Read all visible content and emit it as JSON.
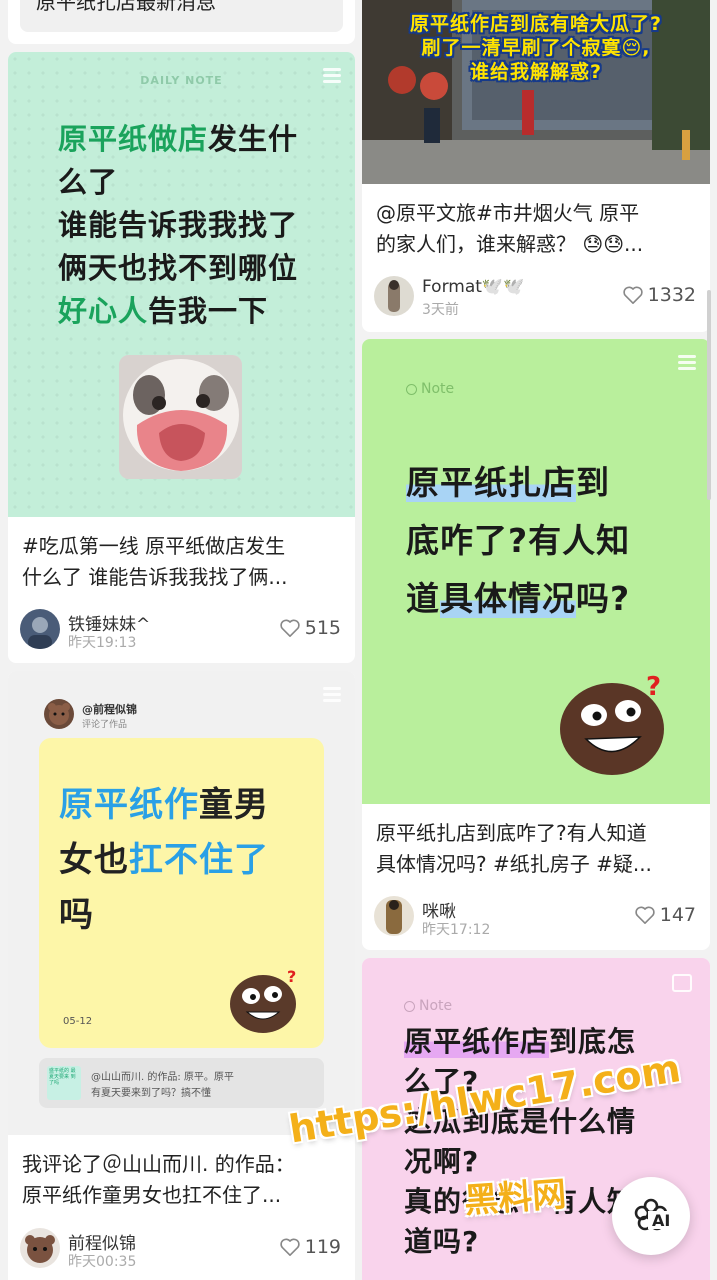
{
  "top_card": {
    "caption": "原平纸扎店最新消息"
  },
  "cards": {
    "c1": {
      "cover_tag": "DAILY NOTE",
      "cover_lines": [
        "原平纸做店发生什",
        "么了",
        "谁能告诉我我找了",
        "俩天也找不到哪位",
        "好心人告我一下"
      ],
      "caption": [
        "#吃瓜第一线 原平纸做店发生",
        "什么了 谁能告诉我我找了俩..."
      ],
      "user": "铁锤妹妹^",
      "time": "昨天19:13",
      "likes": "515"
    },
    "c2": {
      "cover_user": "@前程似锦",
      "cover_user_sub": "评论了作品",
      "cover_lines": [
        "原平纸作童男",
        "女也扛不住了",
        "吗"
      ],
      "cover_date": "05-12",
      "quote_line1": "@山山而川. 的作品: 原平。原平",
      "quote_line2": "有夏天要来到了吗？搞不懂",
      "quote_thumb": "盛平纸的 最夏天要来 到了吗",
      "caption": [
        "我评论了＠山山而川. 的作品：",
        "原平纸作童男女也扛不住了..."
      ],
      "user": "前程似锦",
      "time": "昨天00:35",
      "likes": "119"
    },
    "c3": {
      "cover_lines": [
        "原平纸作店到底有啥大瓜了?",
        "刷了一清早刷了个寂寞😔,",
        "谁给我解解惑?"
      ],
      "caption": [
        "@原平文旅#市井烟火气 原平",
        "的家人们，谁来解惑？ 😓😓..."
      ],
      "user": "Format🕊️🕊️",
      "time": "3天前",
      "likes": "1332"
    },
    "c4": {
      "cover_tag": "Note",
      "cover_lines": [
        "原平纸扎店到",
        "底咋了?有人知",
        "道具体情况吗?"
      ],
      "caption": [
        "原平纸扎店到底咋了?有人知道",
        "具体情况吗? #纸扎房子 #疑..."
      ],
      "user": "咪啾",
      "time": "昨天17:12",
      "likes": "147"
    },
    "c5": {
      "cover_tag": "Note",
      "cover_lines": [
        "原平纸作店到底怎",
        "么了?",
        "这瓜到底是什么情",
        "况啊?",
        "真的很急！有人知",
        "道吗?"
      ]
    }
  },
  "watermark": {
    "url": "https:/hlwc17.com",
    "name": "黑料网"
  },
  "ai_button": {
    "label": "AI",
    "icon": "ai-flower-icon"
  },
  "colors": {
    "mint": "#bdecd4",
    "yellow": "#fdf6a8",
    "green_note": "#b9ef9c",
    "pink_note": "#f9d3ec",
    "blue_text": "#2aa0e6",
    "green_text": "#1aa35c"
  }
}
